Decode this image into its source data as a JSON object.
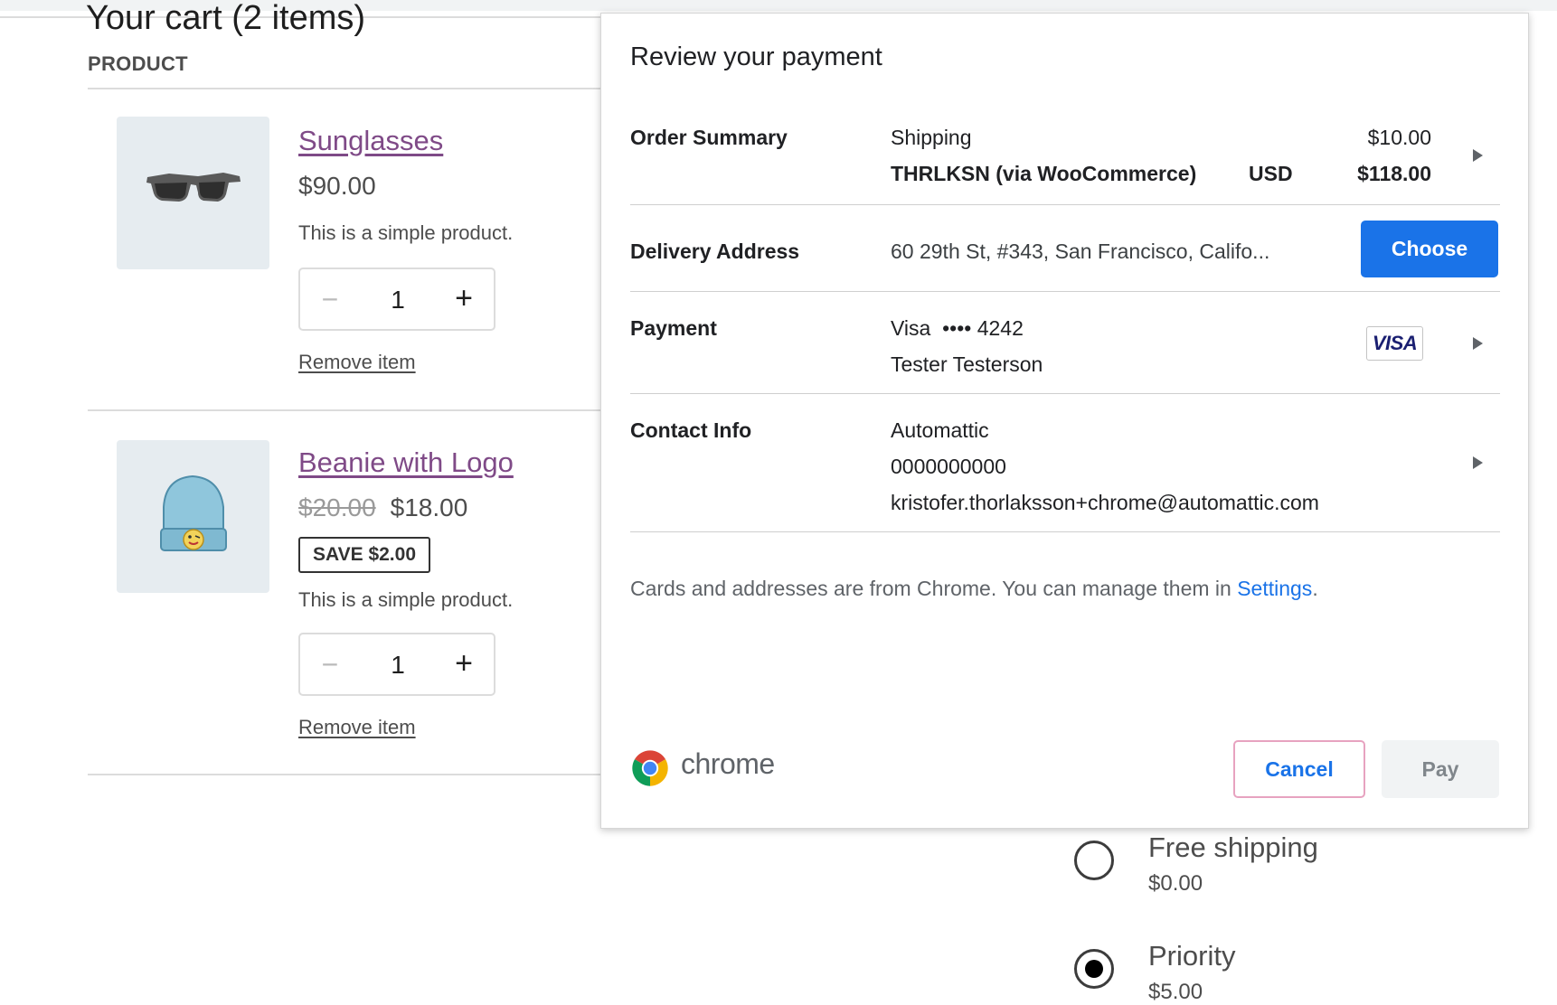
{
  "cart": {
    "title": "Your cart (2 items)",
    "column_header": "PRODUCT",
    "items": [
      {
        "name": "Sunglasses",
        "price": "$90.00",
        "description": "This is a simple product.",
        "quantity": "1",
        "remove_label": "Remove item",
        "image_icon": "sunglasses-image"
      },
      {
        "name": "Beanie with Logo",
        "original_price": "$20.00",
        "price": "$18.00",
        "save_badge": "SAVE $2.00",
        "description": "This is a simple product.",
        "quantity": "1",
        "remove_label": "Remove item",
        "image_icon": "beanie-image"
      }
    ],
    "stepper": {
      "minus_symbol": "−",
      "plus_symbol": "+"
    }
  },
  "shipping_options": [
    {
      "label": "Free shipping",
      "price": "$0.00",
      "selected": false
    },
    {
      "label": "Priority",
      "price": "$5.00",
      "selected": true
    }
  ],
  "payment_dialog": {
    "title": "Review your payment",
    "order_summary": {
      "label": "Order Summary",
      "line_label": "Shipping",
      "line_amount": "$10.00",
      "merchant": "THRLKSN (via WooCommerce)",
      "currency": "USD",
      "total": "$118.00"
    },
    "delivery_address": {
      "label": "Delivery Address",
      "value": "60 29th St, #343, San Francisco, Califo...",
      "button_label": "Choose"
    },
    "payment": {
      "label": "Payment",
      "card_line": "Visa  •••• 4242",
      "cardholder": "Tester Testerson",
      "card_brand": "VISA"
    },
    "contact_info": {
      "label": "Contact Info",
      "name": "Automattic",
      "phone": "0000000000",
      "email": "kristofer.thorlaksson+chrome@automattic.com"
    },
    "footnote_text": "Cards and addresses are from Chrome. You can manage them in ",
    "footnote_link": "Settings",
    "footnote_end": ".",
    "brand_word": "chrome",
    "cancel_label": "Cancel",
    "pay_label": "Pay",
    "colors": {
      "primary_blue": "#1a73e8",
      "link_purple": "#7f4a87"
    }
  }
}
